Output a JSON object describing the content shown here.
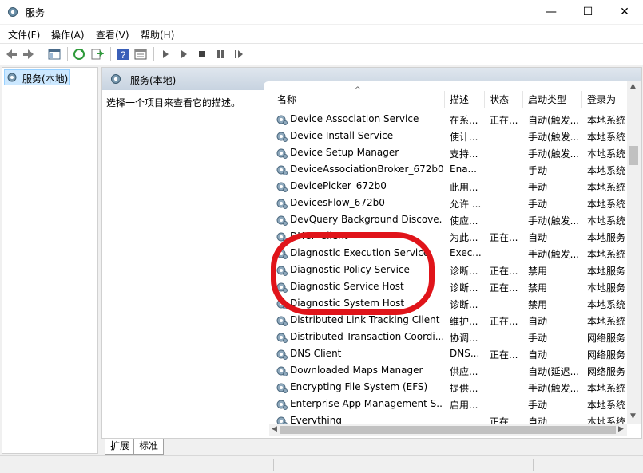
{
  "window": {
    "title": "服务",
    "icon": "services-gear-icon",
    "controls": {
      "minimize": "—",
      "maximize": "☐",
      "close": "✕"
    }
  },
  "menu": [
    "文件(F)",
    "操作(A)",
    "查看(V)",
    "帮助(H)"
  ],
  "toolbar": {
    "buttons": [
      "back-icon",
      "forward-icon",
      "console-tree-icon",
      "refresh-icon",
      "export-icon",
      "help-icon",
      "properties-icon",
      "start-icon",
      "start-alt-icon",
      "stop-icon",
      "pause-icon",
      "restart-icon"
    ]
  },
  "tree": {
    "item": "服务(本地)"
  },
  "panel": {
    "header": "服务(本地)",
    "description": "选择一个项目来查看它的描述。"
  },
  "list": {
    "sort_indicator": "^",
    "columns": [
      "名称",
      "描述",
      "状态",
      "启动类型",
      "登录为"
    ],
    "rows": [
      [
        "Device Association Service",
        "在系...",
        "正在...",
        "自动(触发...",
        "本地系统"
      ],
      [
        "Device Install Service",
        "使计...",
        "",
        "手动(触发...",
        "本地系统"
      ],
      [
        "Device Setup Manager",
        "支持...",
        "",
        "手动(触发...",
        "本地系统"
      ],
      [
        "DeviceAssociationBroker_672b0",
        "Ena...",
        "",
        "手动",
        "本地系统"
      ],
      [
        "DevicePicker_672b0",
        "此用...",
        "",
        "手动",
        "本地系统"
      ],
      [
        "DevicesFlow_672b0",
        "允许 ...",
        "",
        "手动",
        "本地系统"
      ],
      [
        "DevQuery Background Discove...",
        "使应...",
        "",
        "手动(触发...",
        "本地系统"
      ],
      [
        "DHCP Client",
        "为此...",
        "正在...",
        "自动",
        "本地服务"
      ],
      [
        "Diagnostic Execution Service",
        "Exec...",
        "",
        "手动(触发...",
        "本地系统"
      ],
      [
        "Diagnostic Policy Service",
        "诊断...",
        "正在...",
        "禁用",
        "本地服务"
      ],
      [
        "Diagnostic Service Host",
        "诊断...",
        "正在...",
        "禁用",
        "本地服务"
      ],
      [
        "Diagnostic System Host",
        "诊断...",
        "",
        "禁用",
        "本地系统"
      ],
      [
        "Distributed Link Tracking Client",
        "维护...",
        "正在...",
        "自动",
        "本地系统"
      ],
      [
        "Distributed Transaction Coordi...",
        "协调...",
        "",
        "手动",
        "网络服务"
      ],
      [
        "DNS Client",
        "DNS...",
        "正在...",
        "自动",
        "网络服务"
      ],
      [
        "Downloaded Maps Manager",
        "供应...",
        "",
        "自动(延迟...",
        "网络服务"
      ],
      [
        "Encrypting File System (EFS)",
        "提供...",
        "",
        "手动(触发...",
        "本地系统"
      ],
      [
        "Enterprise App Management S...",
        "启用...",
        "",
        "手动",
        "本地系统"
      ],
      [
        "Everything",
        "",
        "正在...",
        "自动",
        "本地系统"
      ]
    ]
  },
  "tabs": [
    "扩展",
    "标准"
  ],
  "colors": {
    "annotation": "#e0141a",
    "selection": "#cce8ff"
  }
}
